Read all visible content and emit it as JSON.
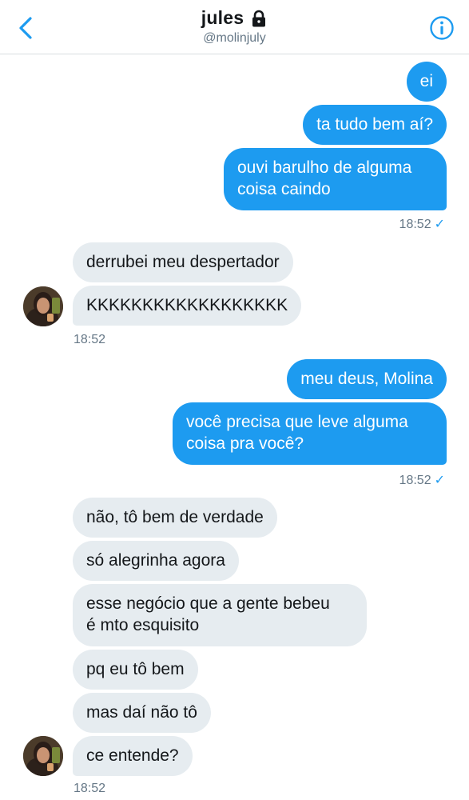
{
  "header": {
    "name": "jules",
    "handle": "@molinjuly"
  },
  "messages": {
    "out1": "ei",
    "out2": "ta tudo bem aí?",
    "out3": "ouvi barulho de alguma\ncoisa caindo",
    "out_time1": "18:52",
    "in1": "derrubei meu despertador",
    "in2": "KKKKKKKKKKKKKKKKKK",
    "in_time1": "18:52",
    "out4": "meu deus, Molina",
    "out5": "você precisa que leve alguma\ncoisa pra você?",
    "out_time2": "18:52",
    "in3": "não, tô bem de verdade",
    "in4": "só alegrinha agora",
    "in5": "esse negócio que a gente bebeu\né mto esquisito",
    "in6": "pq eu tô bem",
    "in7": "mas daí não tô",
    "in8": "ce entende?",
    "in_time2": "18:52"
  },
  "colors": {
    "accent": "#1d9bf0",
    "incoming_bubble": "#e6ecf0",
    "meta_text": "#657786"
  },
  "icons": {
    "back": "chevron-left-icon",
    "lock": "lock-icon",
    "info": "info-icon",
    "read": "checkmark-icon"
  }
}
